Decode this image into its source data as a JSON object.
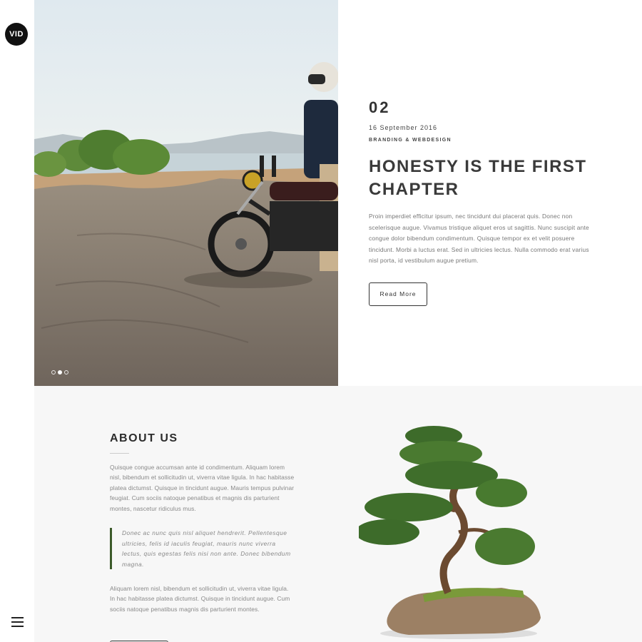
{
  "brand": {
    "logo_text": "VID"
  },
  "nav": {
    "menu_icon": "hamburger-icon"
  },
  "hero": {
    "number": "02",
    "date": "16 September 2016",
    "category": "BRANDING & WEBDESIGN",
    "title": "HONESTY IS THE FIRST CHAPTER",
    "paragraph": "Proin imperdiet efficitur ipsum, nec tincidunt dui placerat quis. Donec non scelerisque augue. Vivamus tristique aliquet eros ut sagittis. Nunc suscipit ante congue dolor bibendum condimentum. Quisque tempor ex et velit posuere tincidunt. Morbi a luctus erat. Sed in ultricies lectus. Nulla commodo erat varius nisl porta, id vestibulum augue pretium.",
    "button_label": "Read More",
    "slides": {
      "count": 3,
      "active": 2
    }
  },
  "about": {
    "title": "ABOUT US",
    "paragraph1": "Quisque congue accumsan ante id condimentum. Aliquam lorem nisl, bibendum et sollicitudin ut, viverra vitae ligula. In hac habitasse platea dictumst. Quisque in tincidunt augue. Mauris tempus pulvinar feugiat. Cum sociis natoque penatibus et magnis dis parturient montes, nascetur ridiculus mus.",
    "quote": "Donec ac nunc quis nisl aliquet hendrerit. Pellentesque ultricies, felis id iaculis feugiat, mauris nunc viverra lectus, quis egestas felis nisi non ante. Donec bibendum magna.",
    "paragraph2": "Aliquam lorem nisl, bibendum et sollicitudin ut, viverra vitae ligula. In hac habitasse platea dictumst. Quisque in tincidunt augue. Cum sociis natoque penatibus magnis dis parturient montes."
  },
  "colors": {
    "accent": "#3c5a2a",
    "text_dark": "#333333",
    "section_bg": "#f7f7f7"
  }
}
